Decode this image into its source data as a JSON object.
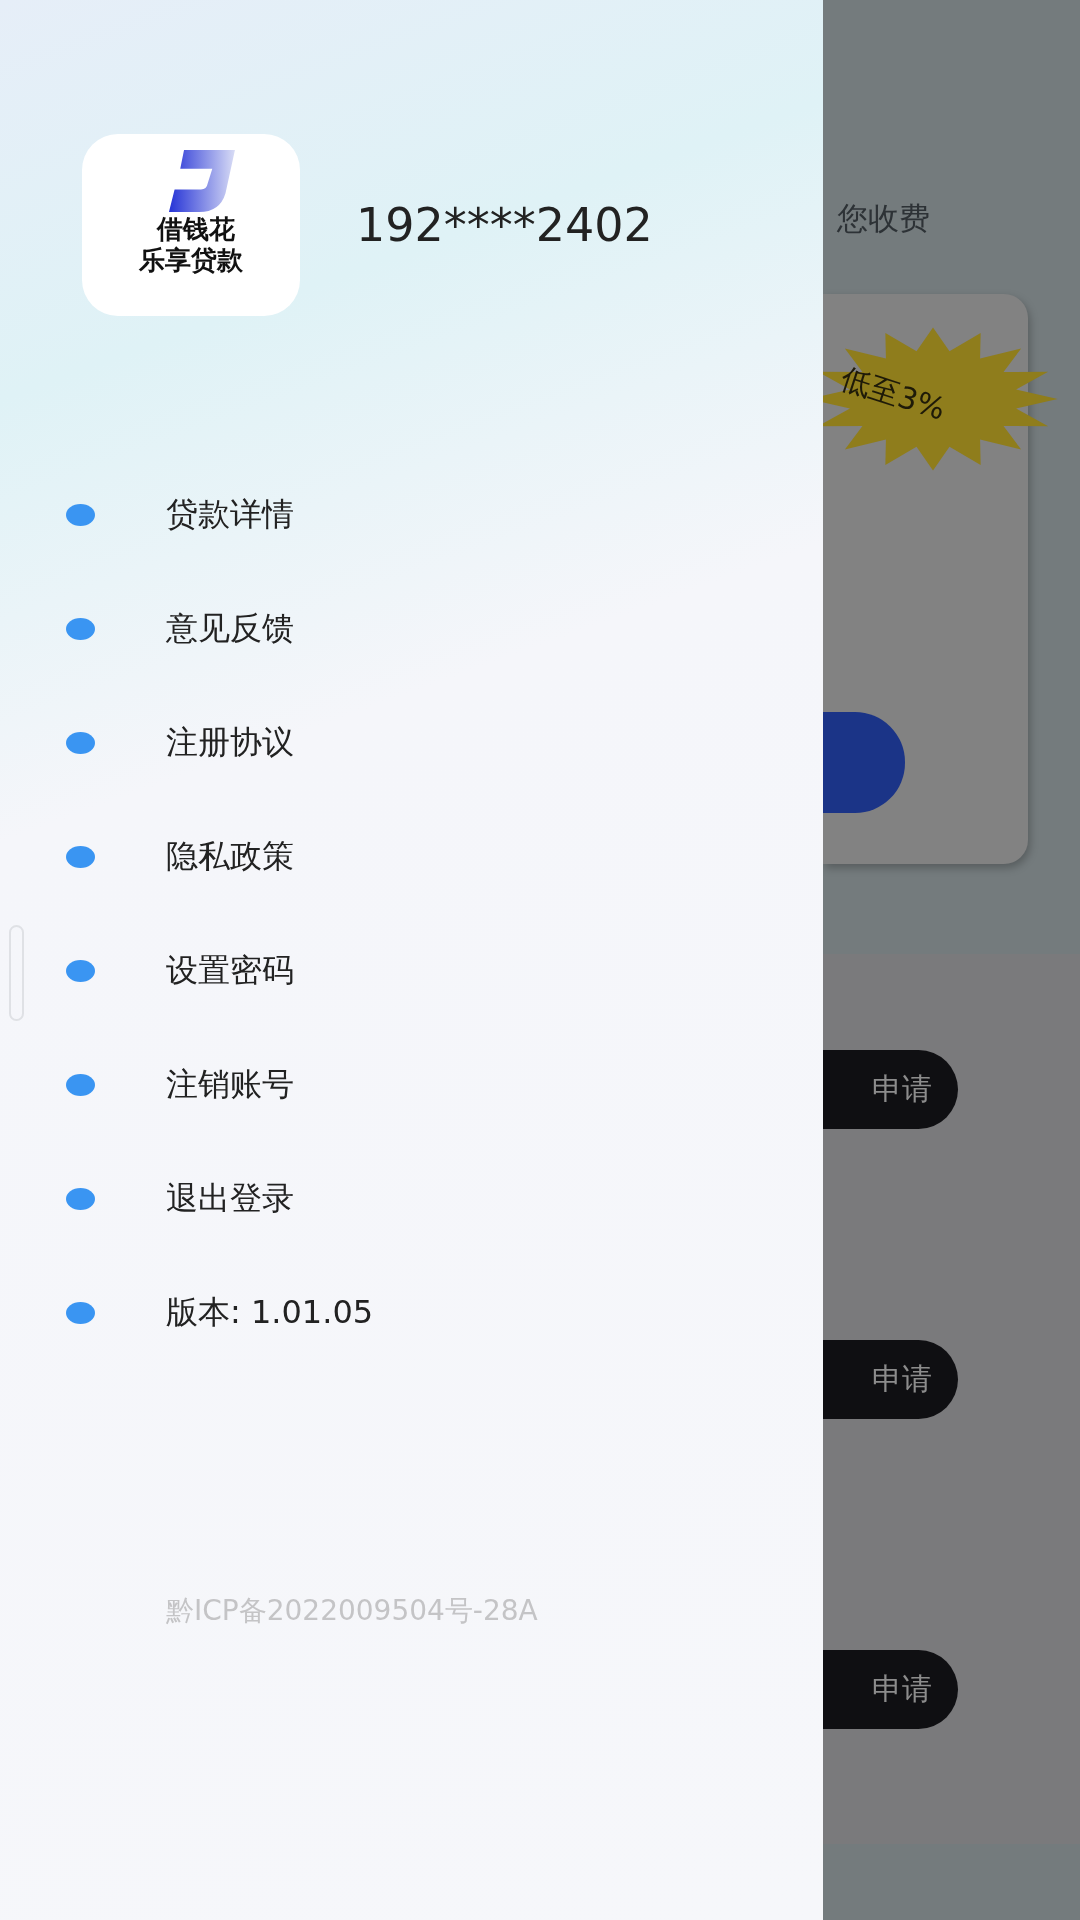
{
  "drawer": {
    "logo": {
      "line_1": "借钱花",
      "line_2": "乐享贷款"
    },
    "phone": "192****2402",
    "menu": [
      {
        "label": "贷款详情"
      },
      {
        "label": "意见反馈"
      },
      {
        "label": "注册协议"
      },
      {
        "label": "隐私政策"
      },
      {
        "label": "设置密码"
      },
      {
        "label": "注销账号"
      },
      {
        "label": "退出登录"
      },
      {
        "label": "版本: 1.01.05"
      }
    ],
    "icp": "黔ICP备2022009504号-28A"
  },
  "background": {
    "notice": "您收费",
    "promo_card": {
      "badge": "低至3%"
    },
    "apply_buttons": [
      "申请",
      "申请",
      "申请"
    ]
  }
}
